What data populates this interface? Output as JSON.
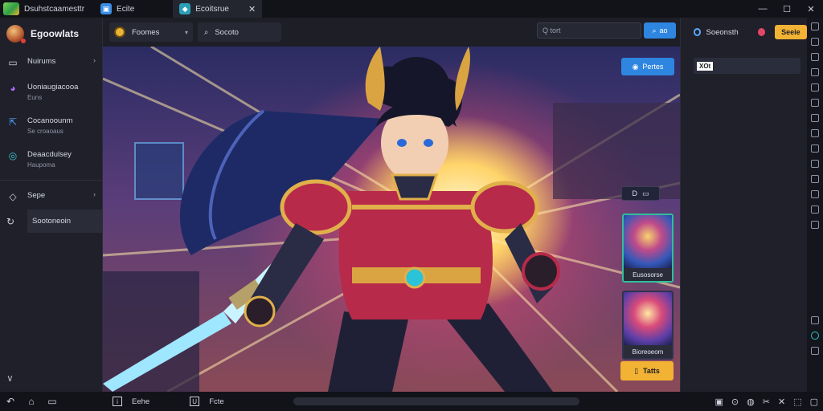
{
  "titlebar": {
    "app_title": "Dsuhstcaamesttr",
    "tabs": [
      {
        "label": "Ecite",
        "icon": "app-tab-icon"
      },
      {
        "label": "Ecoitsrue",
        "icon": "game-tab-icon"
      }
    ]
  },
  "sidebar": {
    "brand": "Egoowlats",
    "items": [
      {
        "label": "Nuirums",
        "sub": "",
        "icon": "library-icon"
      },
      {
        "label": "Uoniaugiacooa",
        "sub": "Euns",
        "icon": "cards-icon"
      },
      {
        "label": "Cocanoounm",
        "sub": "Se croaoaus",
        "icon": "share-icon"
      },
      {
        "label": "Deaacdulsey",
        "sub": "Haupoma",
        "icon": "compass-icon"
      },
      {
        "label": "Sepe",
        "sub": "",
        "icon": "diamond-icon"
      },
      {
        "label": "Sootoneoin",
        "sub": "",
        "icon": "refresh-icon"
      }
    ]
  },
  "mainbar": {
    "dropdown_label": "Foomes",
    "search_tab_label": "Socoto",
    "search_placeholder": "Q tort",
    "search_button": "ao"
  },
  "hero": {
    "top_button": "Pertes",
    "chip_label": "D",
    "cards": [
      {
        "label": "Eusosorse"
      },
      {
        "label": "Bioreoeom"
      }
    ],
    "gold_button": "Tatts"
  },
  "right_panel": {
    "link_label": "Soeonsth",
    "gold_button": "Seeie",
    "field_tag": "XOt"
  },
  "bottombar": {
    "items": [
      {
        "label": "Eehe"
      },
      {
        "label": "Fcte"
      }
    ]
  },
  "colors": {
    "accent_blue": "#2f86e0",
    "accent_gold": "#f2b233",
    "bg_dark": "#1b1c24"
  }
}
